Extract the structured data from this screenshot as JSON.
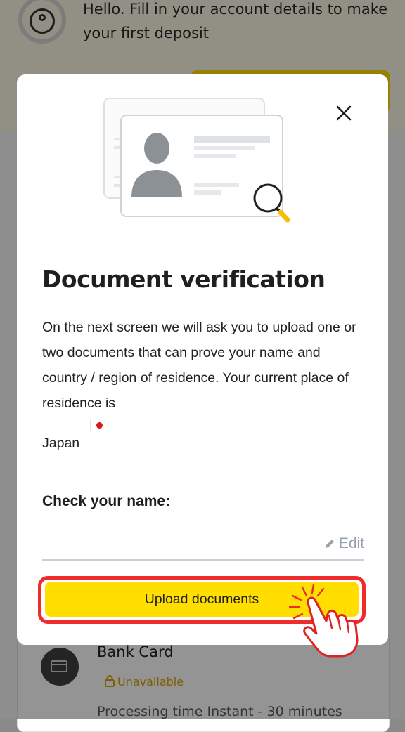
{
  "background": {
    "greeting": "Hello. Fill in your account details to make your first deposit",
    "payment_method": {
      "title": "Bank Card",
      "status": "Unavailable",
      "processing_time": "Processing time Instant - 30 minutes"
    }
  },
  "modal": {
    "title": "Document verification",
    "body": "On the next screen we will ask you to upload one or two documents that can prove your name and country / region of residence. Your current place of residence is",
    "country": "Japan",
    "name_label": "Check your name:",
    "edit_label": "Edit",
    "upload_button": "Upload documents"
  },
  "colors": {
    "accent_yellow": "#ffde00",
    "highlight_red": "#ef2b2b",
    "lock_amber": "#d9a400"
  },
  "icons": [
    "user-circle-icon",
    "close-icon",
    "id-card-illustration",
    "magnifier-icon",
    "japan-flag-icon",
    "pencil-icon",
    "bank-card-icon",
    "lock-icon",
    "pointing-hand-icon"
  ]
}
